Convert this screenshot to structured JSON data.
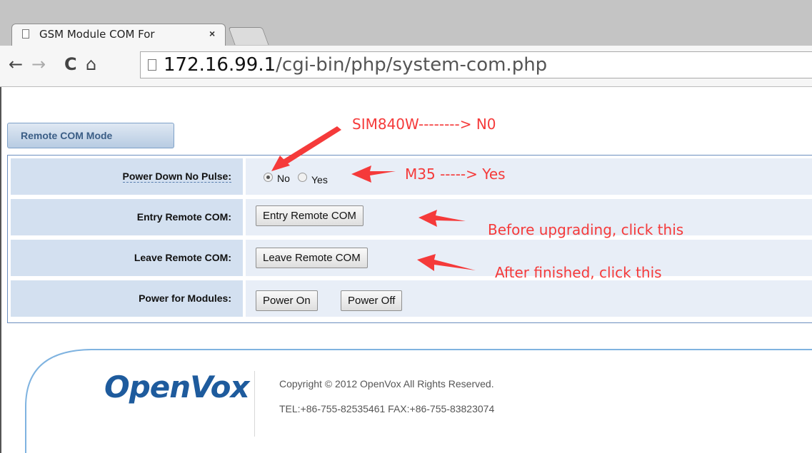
{
  "browser": {
    "tab_title": "GSM Module COM For",
    "tab_close": "×",
    "url_host": "172.16.99.1",
    "url_path": "/cgi-bin/php/system-com.php",
    "back_icon": "←",
    "forward_icon": "→",
    "reload_icon": "C",
    "home_icon": "⌂"
  },
  "page": {
    "mode_tab": "Remote COM Mode",
    "rows": [
      {
        "label": "Power Down No Pulse:"
      },
      {
        "label": "Entry Remote COM:"
      },
      {
        "label": "Leave Remote COM:"
      },
      {
        "label": "Power for Modules:"
      }
    ],
    "radio_no": "No",
    "radio_yes": "Yes",
    "radio_selected": "No",
    "entry_button": "Entry Remote COM",
    "leave_button": "Leave Remote COM",
    "power_on_button": "Power On",
    "power_off_button": "Power Off"
  },
  "annotations": {
    "sim840w": "SIM840W--------> N0",
    "m35": "M35 -----> Yes",
    "before": "Before upgrading, click this",
    "after": "After finished, click this",
    "color": "#f53a3a"
  },
  "footer": {
    "logo": "OpenVox",
    "copyright": "Copyright © 2012 OpenVox All Rights Reserved.",
    "contact": "TEL:+86-755-82535461 FAX:+86-755-83823074"
  }
}
